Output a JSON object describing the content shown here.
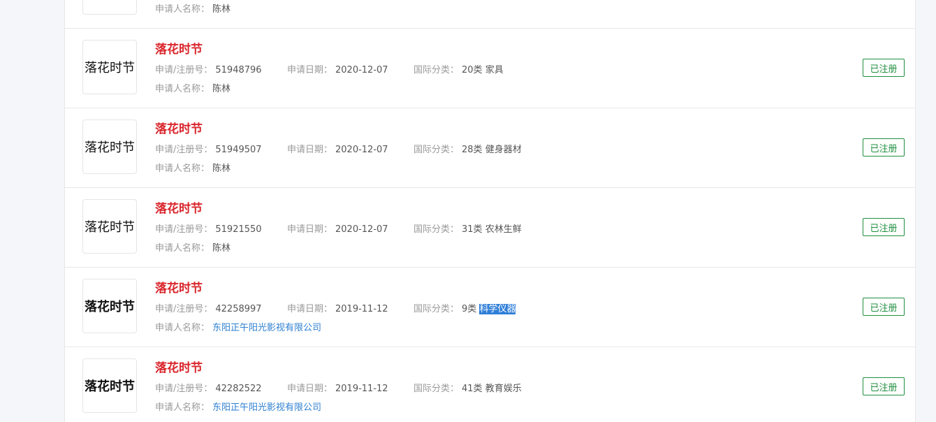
{
  "labels": {
    "reg_no": "申请/注册号：",
    "date": "申请日期：",
    "class": "国际分类：",
    "applicant": "申请人名称："
  },
  "items": [
    {
      "logo_text": "",
      "name": "",
      "reg_no": "",
      "date": "",
      "class_num": "",
      "class_name": "",
      "applicant": "陈林",
      "status": ""
    },
    {
      "logo_text": "落花时节",
      "name": "落花时节",
      "reg_no": "51948796",
      "date": "2020-12-07",
      "class_num": "20类",
      "class_name": "家具",
      "applicant": "陈林",
      "status": "已注册"
    },
    {
      "logo_text": "落花时节",
      "name": "落花时节",
      "reg_no": "51949507",
      "date": "2020-12-07",
      "class_num": "28类",
      "class_name": "健身器材",
      "applicant": "陈林",
      "status": "已注册"
    },
    {
      "logo_text": "落花时节",
      "name": "落花时节",
      "reg_no": "51921550",
      "date": "2020-12-07",
      "class_num": "31类",
      "class_name": "农林生鲜",
      "applicant": "陈林",
      "status": "已注册"
    },
    {
      "logo_text": "落花时节",
      "name": "落花时节",
      "reg_no": "42258997",
      "date": "2019-11-12",
      "class_num": "9类",
      "class_name": "科学仪器",
      "applicant": "东阳正午阳光影视有限公司",
      "status": "已注册"
    },
    {
      "logo_text": "落花时节",
      "name": "落花时节",
      "reg_no": "42282522",
      "date": "2019-11-12",
      "class_num": "41类",
      "class_name": "教育娱乐",
      "applicant": "东阳正午阳光影视有限公司",
      "status": "已注册"
    }
  ]
}
